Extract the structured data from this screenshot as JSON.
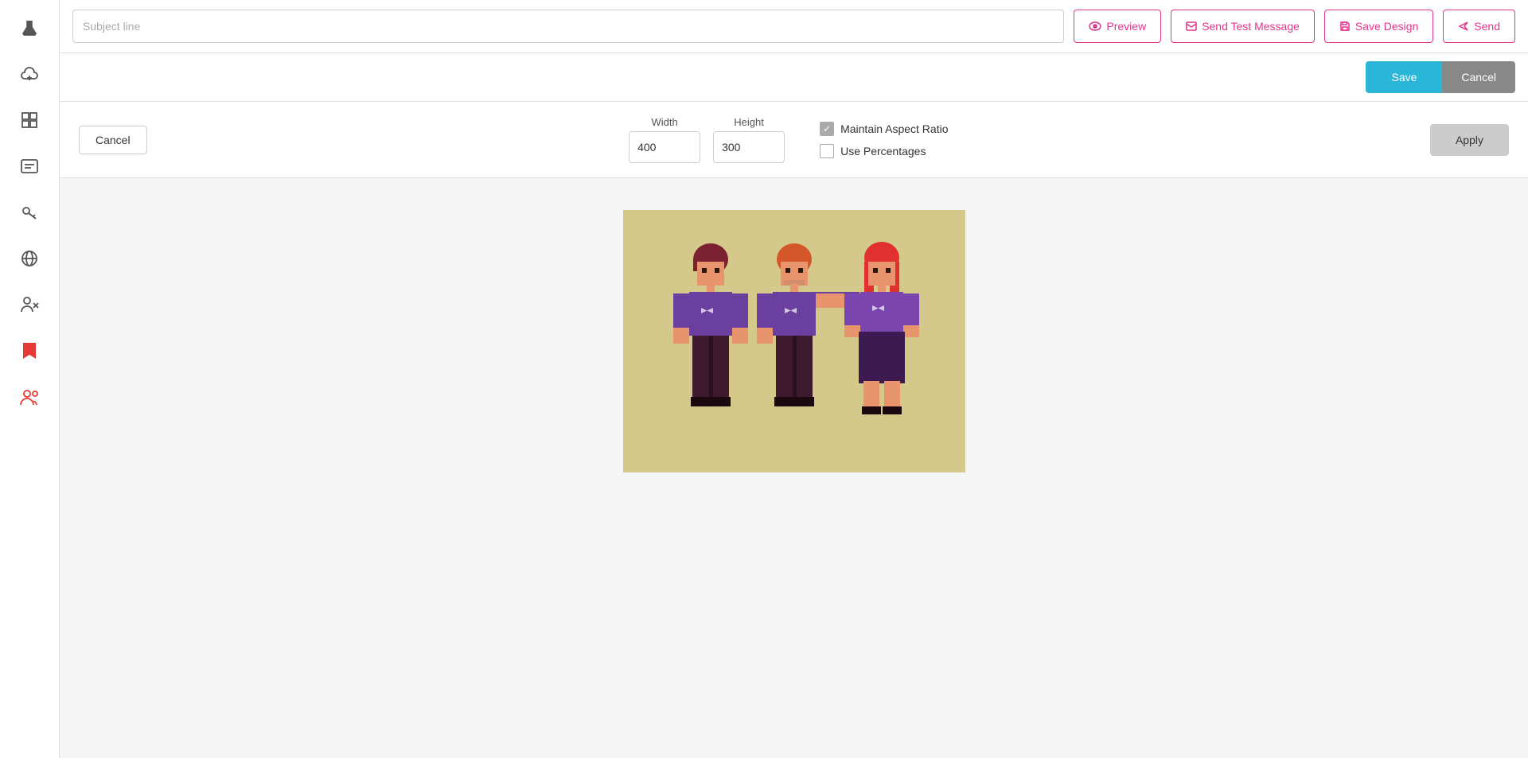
{
  "sidebar": {
    "items": [
      {
        "name": "flask-icon",
        "symbol": "⚗",
        "red": false
      },
      {
        "name": "cloud-icon",
        "symbol": "☁",
        "red": false
      },
      {
        "name": "grid-icon",
        "symbol": "⊞",
        "red": false
      },
      {
        "name": "id-icon",
        "symbol": "≡",
        "red": false
      },
      {
        "name": "key-icon",
        "symbol": "⚷",
        "red": false
      },
      {
        "name": "globe-icon",
        "symbol": "◎",
        "red": false
      },
      {
        "name": "user-remove-icon",
        "symbol": "✖",
        "red": false
      },
      {
        "name": "bookmark-icon",
        "symbol": "🔖",
        "red": true
      },
      {
        "name": "users-icon",
        "symbol": "👥",
        "red": true
      }
    ]
  },
  "topbar": {
    "subject_placeholder": "Subject line",
    "preview_label": "Preview",
    "send_test_label": "Send Test Message",
    "save_design_label": "Save Design",
    "send_label": "Send"
  },
  "action_bar": {
    "save_label": "Save",
    "cancel_label": "Cancel"
  },
  "resize": {
    "cancel_label": "Cancel",
    "width_label": "Width",
    "height_label": "Height",
    "width_value": "400",
    "height_value": "300",
    "maintain_aspect_label": "Maintain Aspect Ratio",
    "use_percentages_label": "Use Percentages",
    "apply_label": "Apply",
    "maintain_aspect_checked": true,
    "use_percentages_checked": false
  }
}
